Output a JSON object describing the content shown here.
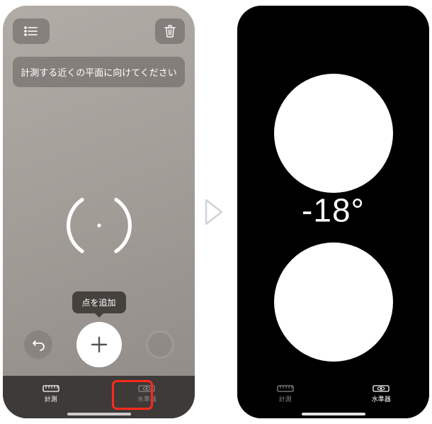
{
  "left": {
    "banner": "計測する近くの平面に向けてください",
    "tooltip": "点を追加",
    "tabs": {
      "measure": "計測",
      "level": "水準器"
    }
  },
  "right": {
    "angle": "-18°",
    "tabs": {
      "measure": "計測",
      "level": "水準器"
    }
  }
}
